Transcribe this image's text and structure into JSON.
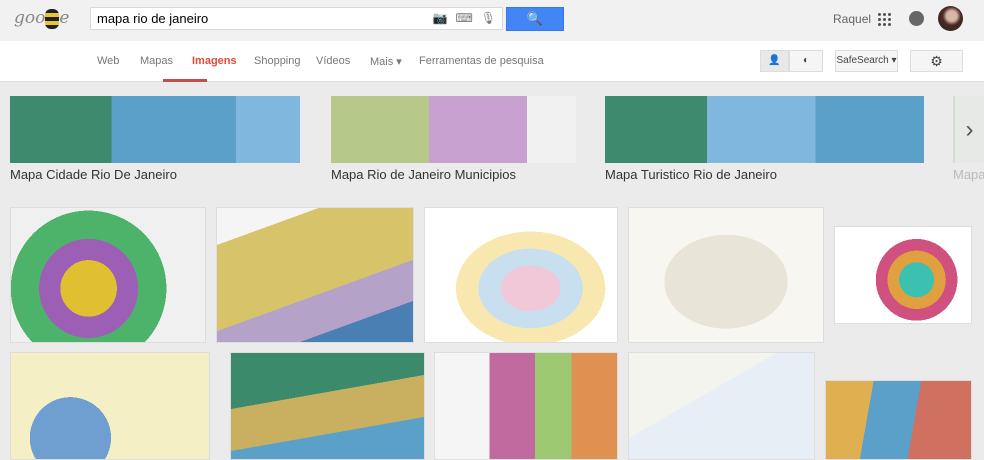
{
  "header": {
    "logo": "google",
    "query": "mapa rio de janeiro",
    "user": "Raquel"
  },
  "nav": {
    "tabs": [
      "Web",
      "Mapas",
      "Imagens",
      "Shopping",
      "Vídeos",
      "Mais ▾",
      "Ferramentas de pesquisa"
    ],
    "active": "Imagens",
    "safesearch": "SafeSearch ▾"
  },
  "related": [
    {
      "label": "Mapa Cidade Rio De Janeiro"
    },
    {
      "label": "Mapa Rio de Janeiro Municipios"
    },
    {
      "label": "Mapa Turistico Rio de Janeiro"
    },
    {
      "label": "Mapa"
    }
  ],
  "colors": {
    "accent": "#4285f4",
    "active_tab": "#dd4b39"
  }
}
